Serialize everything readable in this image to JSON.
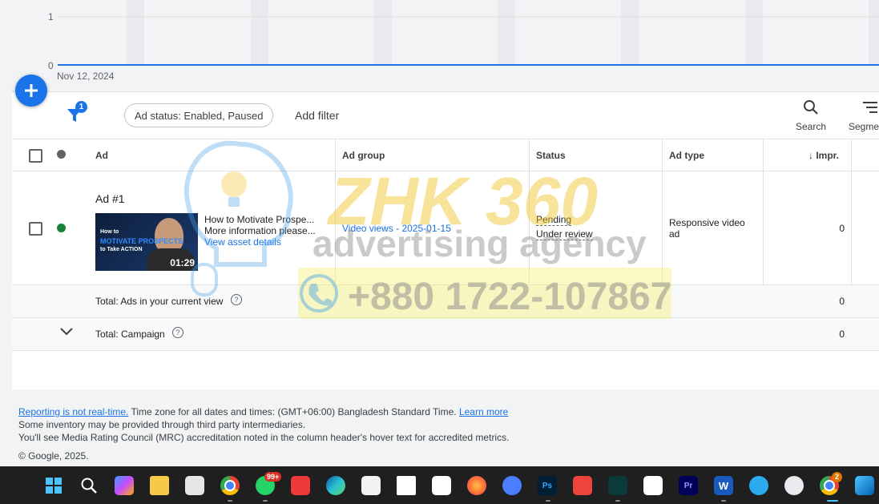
{
  "chart": {
    "y_tick_top": "1",
    "y_tick_bottom": "0",
    "x_tick_label": "Nov 12, 2024",
    "line_color": "#1a73e8"
  },
  "fab": {
    "icon": "plus-icon"
  },
  "toolbar": {
    "filter_badge": "1",
    "status_chip": "Ad status: Enabled, Paused",
    "add_filter": "Add filter",
    "search_label": "Search",
    "segment_label": "Segme"
  },
  "table": {
    "columns": {
      "ad": "Ad",
      "ad_group": "Ad group",
      "status": "Status",
      "ad_type": "Ad type",
      "impr": "Impr."
    },
    "row": {
      "title": "Ad #1",
      "video_title": "How to Motivate Prospe...",
      "video_desc": "More information please...",
      "view_details": "View asset details",
      "ad_group": "Video views - 2025-01-15",
      "status_1": "Pending",
      "status_2": "Under review",
      "ad_type": "Responsive video ad",
      "impr": "0",
      "thumb_line1": "How to",
      "thumb_line2": "MOTIVATE PROSPECTS",
      "thumb_line3": "to Take ACTION",
      "thumb_duration": "01:29"
    },
    "total_view": {
      "label": "Total: Ads in your current view",
      "impr": "0"
    },
    "total_campaign": {
      "label": "Total: Campaign",
      "impr": "0"
    }
  },
  "watermark": {
    "line1": "ZHK 360",
    "line2": "advertising agency",
    "line3": "+880 1722-107867"
  },
  "footer": {
    "realtime_link": "Reporting is not real-time.",
    "timezone_text": " Time zone for all dates and times: (GMT+06:00) Bangladesh Standard Time. ",
    "learn_more": "Learn more",
    "line2": "Some inventory may be provided through third party intermediaries.",
    "line3": "You'll see Media Rating Council (MRC) accreditation noted in the column header's hover text for accredited metrics.",
    "copyright": "© Google, 2025."
  },
  "taskbar": {
    "whatsapp_badge": "99+",
    "chrome_badge": "2",
    "ps_label": "Ps",
    "pr_label": "Pr",
    "word_label": "W",
    "icons": [
      "windows-start-icon",
      "search-icon",
      "copilot-icon",
      "file-explorer-icon",
      "snipping-tool-icon",
      "chrome-icon",
      "whatsapp-icon",
      "vivaldi-icon",
      "edge-icon",
      "microsoft-store-icon",
      "notepad-icon",
      "capcut-icon",
      "firefox-icon",
      "sync-icon",
      "photoshop-icon",
      "anydesk-icon",
      "filmora-icon",
      "capcut-2-icon",
      "premiere-icon",
      "word-icon",
      "telegram-icon",
      "app-icon",
      "chrome-2-icon",
      "photos-icon"
    ]
  }
}
